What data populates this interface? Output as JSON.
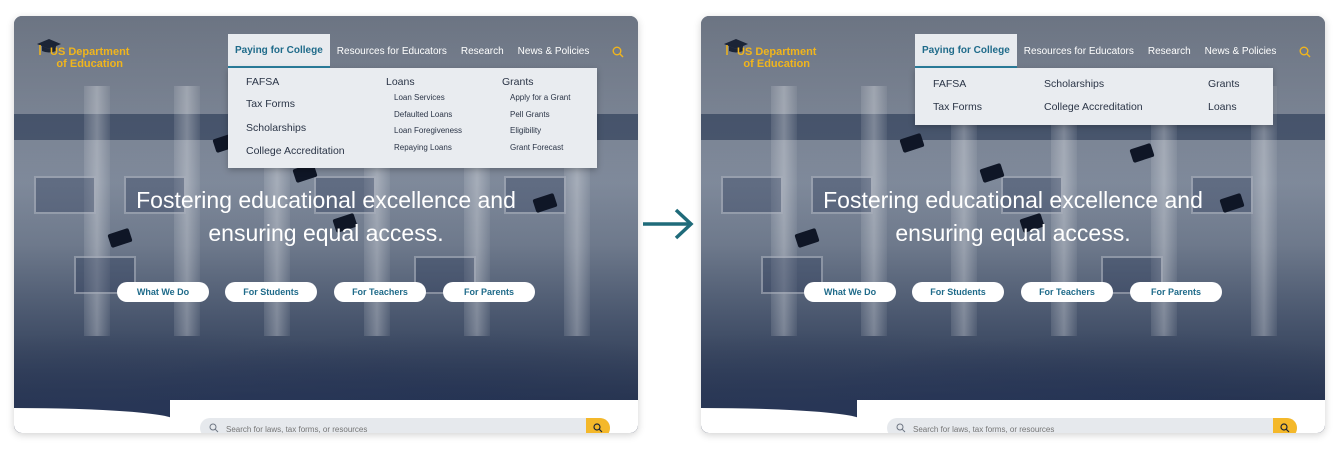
{
  "colors": {
    "accent": "#1f6b8a",
    "gold": "#f1b51c",
    "search_button": "#f4b82a"
  },
  "logo": {
    "line1": "US Department",
    "line2": "of Education",
    "icon": "graduation-cap-icon"
  },
  "nav": {
    "items": [
      "Paying for College",
      "Resources for Educators",
      "Research",
      "News & Policies"
    ],
    "search_icon": "search-icon"
  },
  "before_menu": {
    "col1": [
      "FAFSA",
      "Tax Forms",
      "Scholarships",
      "College Accreditation"
    ],
    "loans": {
      "title": "Loans",
      "items": [
        "Loan Services",
        "Defaulted Loans",
        "Loan Foregiveness",
        "Repaying Loans"
      ]
    },
    "grants": {
      "title": "Grants",
      "items": [
        "Apply for a Grant",
        "Pell Grants",
        "Eligibility",
        "Grant Forecast"
      ]
    }
  },
  "after_menu": {
    "items": [
      "FAFSA",
      "Scholarships",
      "Grants",
      "Tax Forms",
      "College Accreditation",
      "Loans"
    ]
  },
  "hero": {
    "line1": "Fostering educational excellence and",
    "line2": "ensuring equal access."
  },
  "buttons": [
    "What We Do",
    "For Students",
    "For Teachers",
    "For Parents"
  ],
  "search": {
    "placeholder": "Search for laws, tax forms, or resources"
  },
  "transition_arrow": "arrow-right-icon"
}
